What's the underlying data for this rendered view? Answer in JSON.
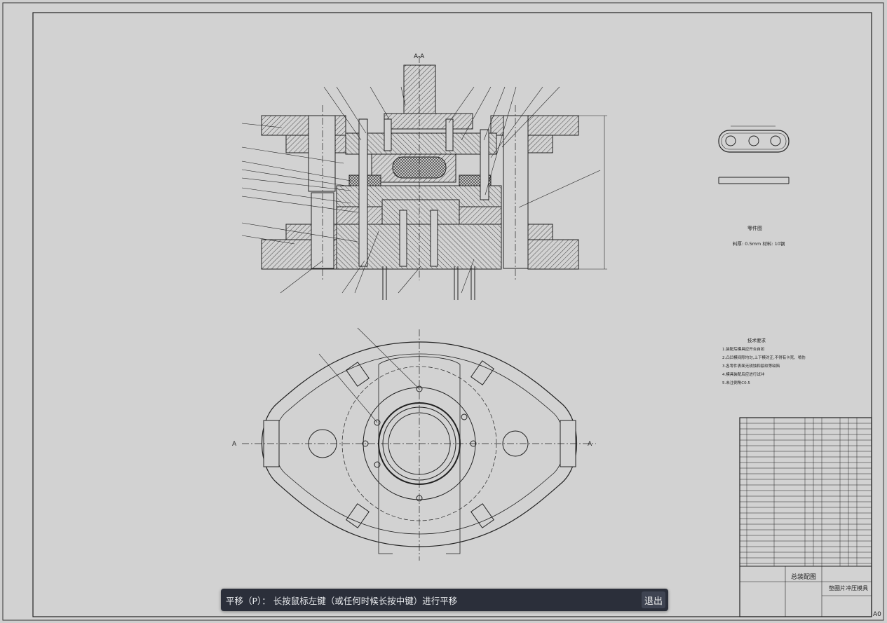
{
  "drawing": {
    "section_label": "A-A",
    "section_marker_left": "A",
    "section_marker_right": "A",
    "part_view_title": "零件图",
    "part_view_material": "料厚: 0.5mm     材料: 10钢",
    "tech_req_title": "技术要求",
    "tech_req_lines": [
      "1.装配后模具应开合自如",
      "2.凸凹模间隙均匀,上下模对正,不得有卡死、啃伤",
      "3.各零件表面无锈蚀和裂纹等缺陷",
      "4.模具装配后应进行试冲",
      "5.未注倒角C0.5"
    ],
    "title_block_name": "总装配图",
    "title_block_product": "垫圈片冲压模具",
    "paper_size": "A0"
  },
  "toast": {
    "message": "平移（P）：  长按鼠标左键（或任何时候长按中键）进行平移",
    "exit_label": "退出"
  }
}
